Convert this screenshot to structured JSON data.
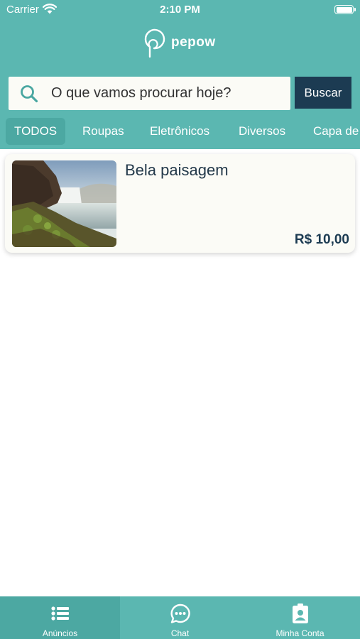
{
  "status_bar": {
    "carrier": "Carrier",
    "time": "2:10 PM"
  },
  "brand": {
    "name": "pepow"
  },
  "search": {
    "placeholder": "O que vamos procurar hoje?",
    "button_label": "Buscar"
  },
  "categories": [
    {
      "label": "TODOS",
      "active": true
    },
    {
      "label": "Roupas"
    },
    {
      "label": "Eletrônicos"
    },
    {
      "label": "Diversos"
    },
    {
      "label": "Capa de"
    }
  ],
  "listings": [
    {
      "title": "Bela paisagem",
      "price": "R$ 10,00",
      "image": "waterfall-landscape-photo"
    }
  ],
  "tabbar": [
    {
      "label": "Anúncios",
      "icon": "list-icon",
      "active": true
    },
    {
      "label": "Chat",
      "icon": "chat-bubble-icon"
    },
    {
      "label": "Minha Conta",
      "icon": "contact-card-icon"
    }
  ],
  "colors": {
    "primary": "#5bb7b1",
    "primary_dark": "#4ca8a2",
    "navy": "#1c3b52",
    "card_background": "#fbfbf6"
  }
}
